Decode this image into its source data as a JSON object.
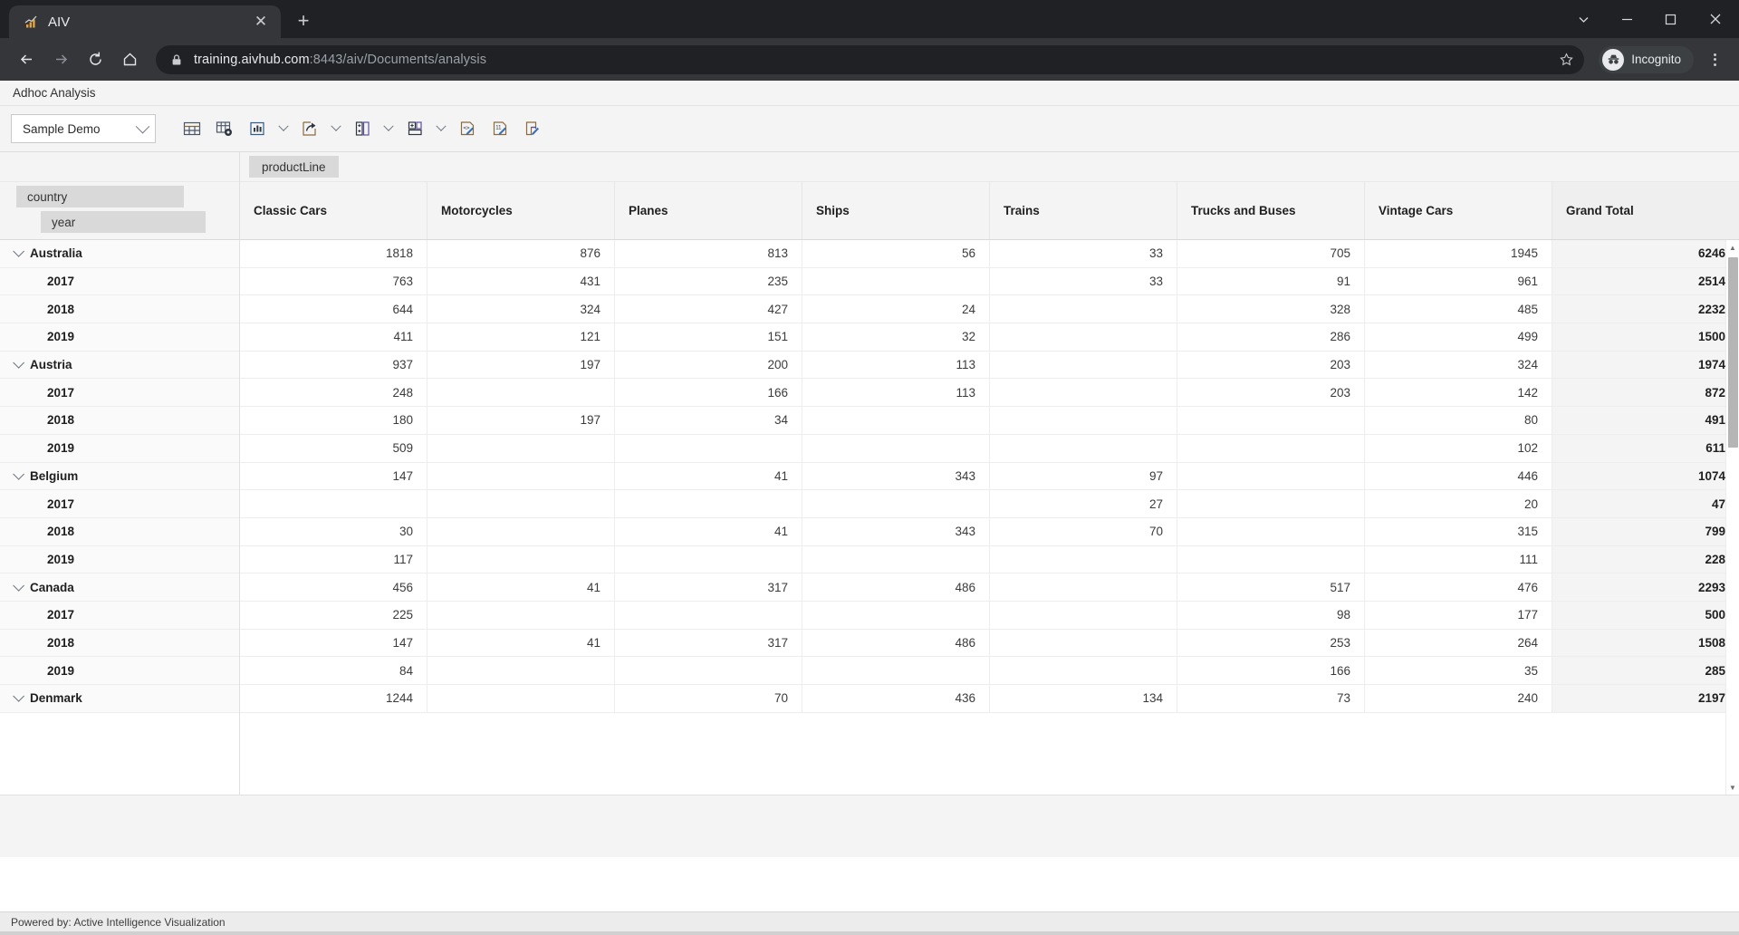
{
  "browser": {
    "tab": {
      "title": "AIV",
      "favicon_icon": "bar-chart-favicon",
      "close_icon": "close-icon"
    },
    "new_tab_label": "+",
    "window_controls": {
      "minimize": "—",
      "maximize": "☐",
      "close": "✕",
      "more": "⌄"
    },
    "nav": {
      "back": "←",
      "forward": "→",
      "reload": "⟳",
      "home": "⌂"
    },
    "url": {
      "lock_icon": "lock-icon",
      "host": "training.aivhub.com",
      "rest": ":8443/aiv/Documents/analysis",
      "star_icon": "star-icon"
    },
    "profile": {
      "label": "Incognito",
      "icon": "incognito-icon"
    },
    "menu_icon": "kebab-menu-icon"
  },
  "app": {
    "title": "Adhoc Analysis",
    "footer": "Powered by: Active Intelligence Visualization"
  },
  "toolbar": {
    "dataset_select": {
      "value": "Sample Demo",
      "caret_icon": "chevron-down-icon"
    },
    "buttons": [
      {
        "name": "table-view-button",
        "icon": "table-grid-icon",
        "caret": false
      },
      {
        "name": "table-settings-button",
        "icon": "table-gear-icon",
        "caret": false
      },
      {
        "name": "chart-button",
        "icon": "bar-chart-icon",
        "caret": true
      },
      {
        "name": "export-share-button",
        "icon": "share-export-icon",
        "caret": true
      },
      {
        "name": "add-column-button",
        "icon": "add-column-icon",
        "caret": true
      },
      {
        "name": "add-row-button",
        "icon": "add-row-icon",
        "caret": true
      },
      {
        "name": "script-editor-button",
        "icon": "code-edit-icon",
        "caret": false
      },
      {
        "name": "number-format-button",
        "icon": "number-edit-icon",
        "caret": false
      },
      {
        "name": "report-edit-button",
        "icon": "report-edit-icon",
        "caret": false
      }
    ]
  },
  "pivot": {
    "row_fields": [
      "country",
      "year"
    ],
    "column_field": "productLine",
    "columns": [
      "Classic Cars",
      "Motorcycles",
      "Planes",
      "Ships",
      "Trains",
      "Trucks and Buses",
      "Vintage Cars",
      "Grand Total"
    ],
    "rows": [
      {
        "label": "Australia",
        "level": "group",
        "values": [
          "1818",
          "876",
          "813",
          "56",
          "33",
          "705",
          "1945",
          "6246"
        ]
      },
      {
        "label": "2017",
        "level": "child",
        "values": [
          "763",
          "431",
          "235",
          "",
          "33",
          "91",
          "961",
          "2514"
        ]
      },
      {
        "label": "2018",
        "level": "child",
        "values": [
          "644",
          "324",
          "427",
          "24",
          "",
          "328",
          "485",
          "2232"
        ]
      },
      {
        "label": "2019",
        "level": "child",
        "values": [
          "411",
          "121",
          "151",
          "32",
          "",
          "286",
          "499",
          "1500"
        ]
      },
      {
        "label": "Austria",
        "level": "group",
        "values": [
          "937",
          "197",
          "200",
          "113",
          "",
          "203",
          "324",
          "1974"
        ]
      },
      {
        "label": "2017",
        "level": "child",
        "values": [
          "248",
          "",
          "166",
          "113",
          "",
          "203",
          "142",
          "872"
        ]
      },
      {
        "label": "2018",
        "level": "child",
        "values": [
          "180",
          "197",
          "34",
          "",
          "",
          "",
          "80",
          "491"
        ]
      },
      {
        "label": "2019",
        "level": "child",
        "values": [
          "509",
          "",
          "",
          "",
          "",
          "",
          "102",
          "611"
        ]
      },
      {
        "label": "Belgium",
        "level": "group",
        "values": [
          "147",
          "",
          "41",
          "343",
          "97",
          "",
          "446",
          "1074"
        ]
      },
      {
        "label": "2017",
        "level": "child",
        "values": [
          "",
          "",
          "",
          "",
          "27",
          "",
          "20",
          "47"
        ]
      },
      {
        "label": "2018",
        "level": "child",
        "values": [
          "30",
          "",
          "41",
          "343",
          "70",
          "",
          "315",
          "799"
        ]
      },
      {
        "label": "2019",
        "level": "child",
        "values": [
          "117",
          "",
          "",
          "",
          "",
          "",
          "111",
          "228"
        ]
      },
      {
        "label": "Canada",
        "level": "group",
        "values": [
          "456",
          "41",
          "317",
          "486",
          "",
          "517",
          "476",
          "2293"
        ]
      },
      {
        "label": "2017",
        "level": "child",
        "values": [
          "225",
          "",
          "",
          "",
          "",
          "98",
          "177",
          "500"
        ]
      },
      {
        "label": "2018",
        "level": "child",
        "values": [
          "147",
          "41",
          "317",
          "486",
          "",
          "253",
          "264",
          "1508"
        ]
      },
      {
        "label": "2019",
        "level": "child",
        "values": [
          "84",
          "",
          "",
          "",
          "",
          "166",
          "35",
          "285"
        ]
      },
      {
        "label": "Denmark",
        "level": "group",
        "values": [
          "1244",
          "",
          "70",
          "436",
          "134",
          "73",
          "240",
          "2197"
        ]
      }
    ],
    "scrollbar": {
      "up_icon": "scroll-up-arrow",
      "down_icon": "scroll-down-arrow"
    }
  },
  "colors": {
    "chrome_dark": "#202124",
    "chrome_tab": "#35363a",
    "panel_bg": "#f4f4f4",
    "chip_bg": "#d9d9d9",
    "icon_stroke": "#4a5568",
    "accent_orange": "#e8a33d"
  }
}
